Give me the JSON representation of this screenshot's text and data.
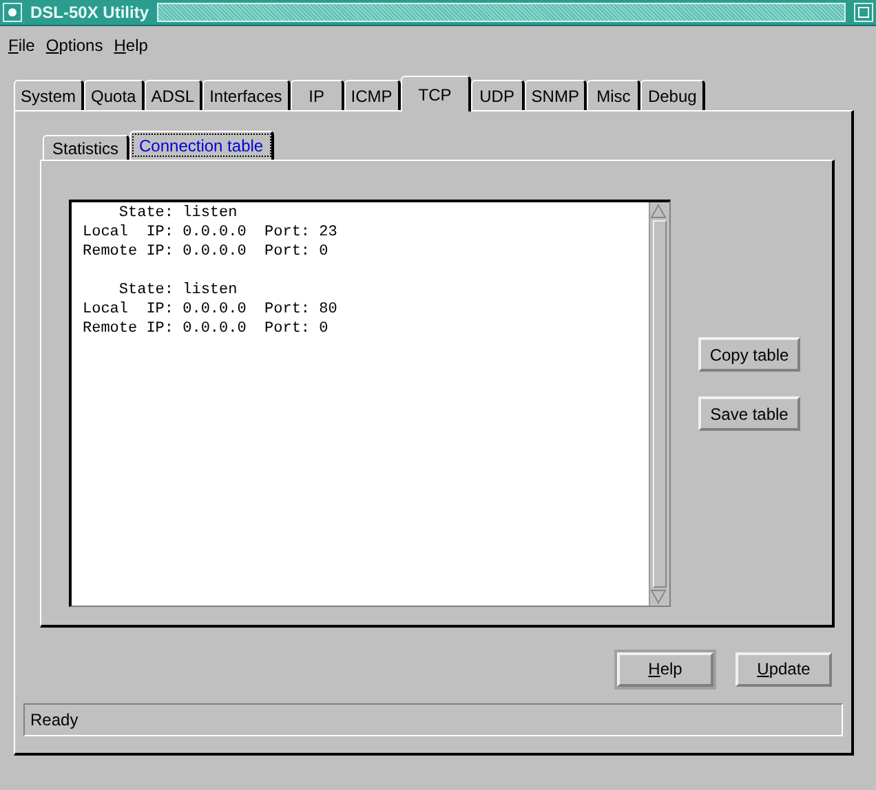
{
  "window": {
    "title": "DSL-50X Utility"
  },
  "menu": [
    {
      "label": "File",
      "mnemonic": true
    },
    {
      "label": "Options",
      "mnemonic": true
    },
    {
      "label": "Help",
      "mnemonic": true
    }
  ],
  "tabs": [
    {
      "label": "System",
      "selected": false
    },
    {
      "label": "Quota",
      "selected": false
    },
    {
      "label": "ADSL",
      "selected": false
    },
    {
      "label": "Interfaces",
      "selected": false
    },
    {
      "label": "IP",
      "selected": false
    },
    {
      "label": "ICMP",
      "selected": false
    },
    {
      "label": "TCP",
      "selected": true
    },
    {
      "label": "UDP",
      "selected": false
    },
    {
      "label": "SNMP",
      "selected": false
    },
    {
      "label": "Misc",
      "selected": false
    },
    {
      "label": "Debug",
      "selected": false
    }
  ],
  "subtabs": [
    {
      "label": "Statistics",
      "selected": false
    },
    {
      "label": "Connection table",
      "selected": true
    }
  ],
  "connection_table": [
    {
      "lines": [
        "    State: listen",
        "Local  IP: 0.0.0.0  Port: 23",
        "Remote IP: 0.0.0.0  Port: 0"
      ]
    },
    {
      "lines": [
        "    State: listen",
        "Local  IP: 0.0.0.0  Port: 80",
        "Remote IP: 0.0.0.0  Port: 0"
      ]
    }
  ],
  "side_buttons": [
    {
      "label": "Copy table"
    },
    {
      "label": "Save table"
    }
  ],
  "buttons": [
    {
      "label": "Help",
      "mnemonic": true,
      "default": true
    },
    {
      "label": "Update",
      "mnemonic": true,
      "default": false
    }
  ],
  "status_bar": "Ready"
}
